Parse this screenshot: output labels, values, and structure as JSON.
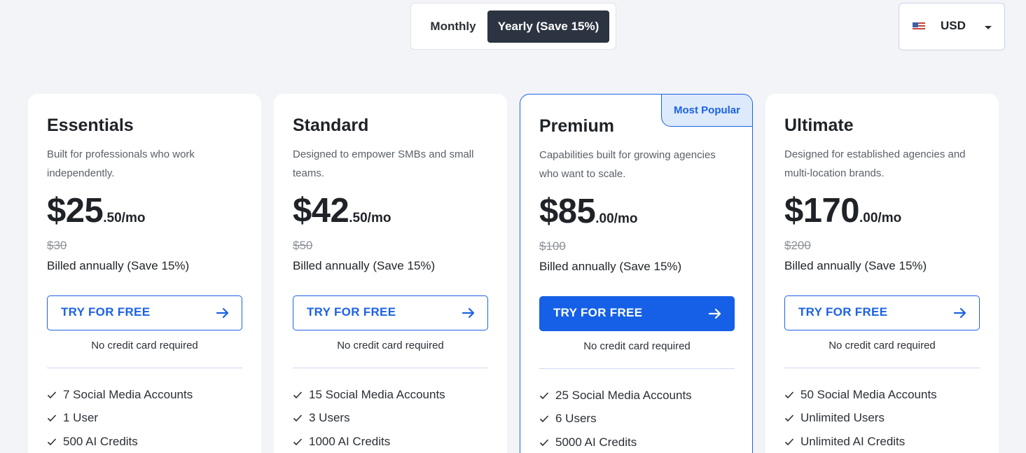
{
  "billing_toggle": {
    "monthly_label": "Monthly",
    "yearly_label": "Yearly (Save 15%)",
    "selected": "yearly"
  },
  "currency": {
    "flag_icon": "us-flag-icon",
    "code": "USD"
  },
  "colors": {
    "accent": "#1c62e5",
    "dark": "#2c3441",
    "badge_bg": "#ddeafc"
  },
  "plans": [
    {
      "name": "Essentials",
      "description": "Built for professionals who work independently.",
      "price_main": "$25",
      "price_cents": ".50/mo",
      "old_price": "$30",
      "billed": "Billed annually (Save 15%)",
      "cta": "TRY FOR FREE",
      "no_cc": "No credit card required",
      "features": [
        "7 Social Media Accounts",
        "1 User",
        "500 AI Credits"
      ]
    },
    {
      "name": "Standard",
      "description": "Designed to empower SMBs and small teams.",
      "price_main": "$42",
      "price_cents": ".50/mo",
      "old_price": "$50",
      "billed": "Billed annually (Save 15%)",
      "cta": "TRY FOR FREE",
      "no_cc": "No credit card required",
      "features": [
        "15 Social Media Accounts",
        "3 Users",
        "1000 AI Credits"
      ]
    },
    {
      "name": "Premium",
      "badge": "Most Popular",
      "description": "Capabilities built for growing agencies who want to scale.",
      "price_main": "$85",
      "price_cents": ".00/mo",
      "old_price": "$100",
      "billed": "Billed annually (Save 15%)",
      "cta": "TRY FOR FREE",
      "no_cc": "No credit card required",
      "features": [
        "25 Social Media Accounts",
        "6 Users",
        "5000 AI Credits"
      ]
    },
    {
      "name": "Ultimate",
      "description": "Designed for established agencies and multi-location brands.",
      "price_main": "$170",
      "price_cents": ".00/mo",
      "old_price": "$200",
      "billed": "Billed annually (Save 15%)",
      "cta": "TRY FOR FREE",
      "no_cc": "No credit card required",
      "features": [
        "50 Social Media Accounts",
        "Unlimited Users",
        "Unlimited AI Credits"
      ]
    }
  ]
}
